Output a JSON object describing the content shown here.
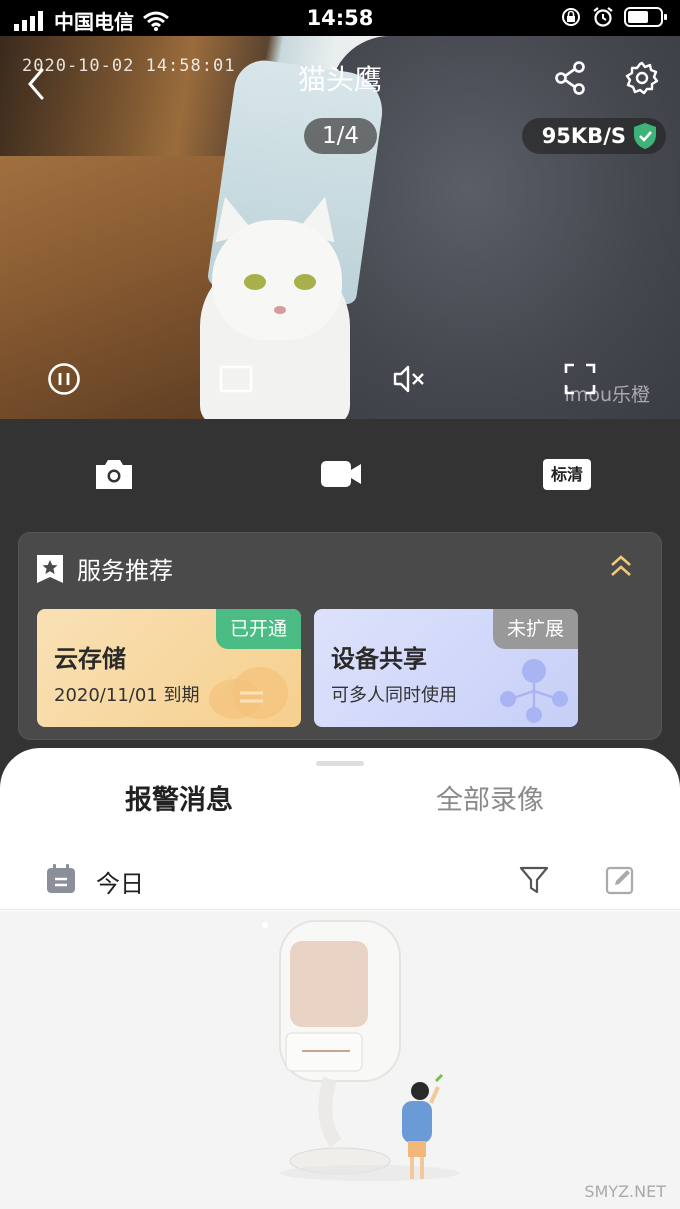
{
  "status_bar": {
    "carrier": "中国电信",
    "time": "14:58"
  },
  "video": {
    "timestamp": "2020-10-02 14:58:01",
    "title": "猫头鹰",
    "counter": "1/4",
    "speed": "95KB/S",
    "watermark": "imou乐橙"
  },
  "control_bar": {
    "quality_label": "标清"
  },
  "service": {
    "title": "服务推荐",
    "cards": [
      {
        "title": "云存储",
        "subtitle": "2020/11/01 到期",
        "badge": "已开通"
      },
      {
        "title": "设备共享",
        "subtitle": "可多人同时使用",
        "badge": "未扩展"
      }
    ]
  },
  "sheet": {
    "tabs": [
      {
        "label": "报警消息",
        "active": true
      },
      {
        "label": "全部录像",
        "active": false
      }
    ],
    "date_label": "今日"
  },
  "footer": {
    "watermark": "SMYZ.NET"
  },
  "colors": {
    "accent_green": "#4cbc85",
    "shield_green": "#3db37a",
    "sheet_bg": "#ffffff",
    "panel_bg": "#4a4a4a"
  }
}
